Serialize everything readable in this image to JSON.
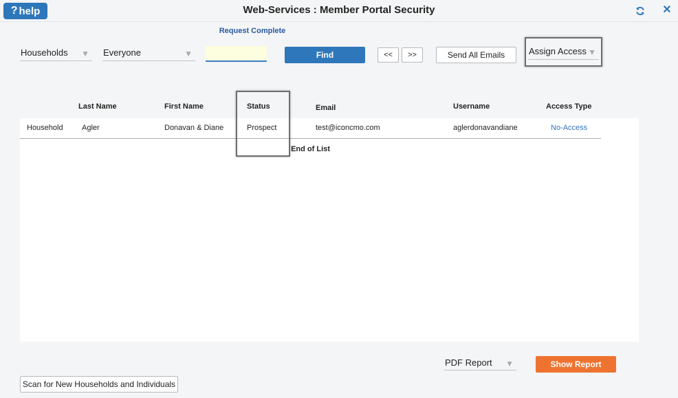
{
  "titlebar": {
    "help_label": "help",
    "help_glyph": "?",
    "title": "Web-Services : Member Portal Security",
    "close_glyph": "✕"
  },
  "status": {
    "message": "Request Complete"
  },
  "filters": {
    "group": "Households",
    "audience": "Everyone",
    "search_value": "",
    "search_placeholder": "",
    "find_label": "Find",
    "prev_label": "<<",
    "next_label": ">>",
    "send_all_label": "Send All Emails",
    "assign_access_label": "Assign Access"
  },
  "table": {
    "headers": {
      "last_name": "Last Name",
      "first_name": "First Name",
      "status": "Status",
      "email": "Email",
      "username": "Username",
      "access_type": "Access Type"
    },
    "rows": [
      {
        "type": "Household",
        "last_name": "Agler",
        "first_name": "Donavan & Diane",
        "status": "Prospect",
        "email": "test@iconcmo.com",
        "username": "aglerdonavandiane",
        "access_type": "No-Access"
      }
    ],
    "end_text": "End of List"
  },
  "footer": {
    "report_select": "PDF Report",
    "show_report_label": "Show Report",
    "scan_label": "Scan for New Households and Individuals"
  },
  "colors": {
    "primary": "#2e77bb",
    "accent": "#ee7330",
    "input_bg": "#fdfde0",
    "status_text": "#2a5aa0"
  },
  "icons": {
    "help": "question-icon",
    "refresh": "refresh-icon",
    "close": "close-icon",
    "dropdown": "caret-down-icon"
  }
}
